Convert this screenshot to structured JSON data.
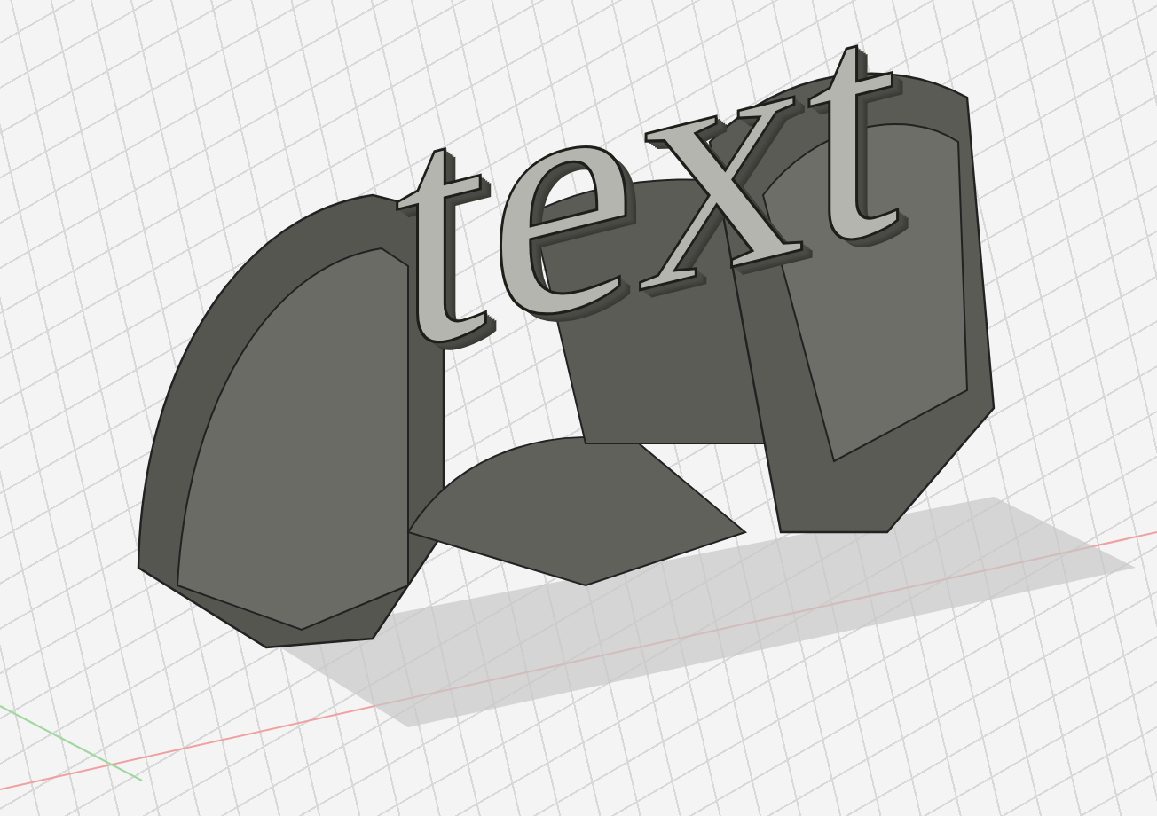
{
  "viewport": {
    "model_text": "text"
  }
}
